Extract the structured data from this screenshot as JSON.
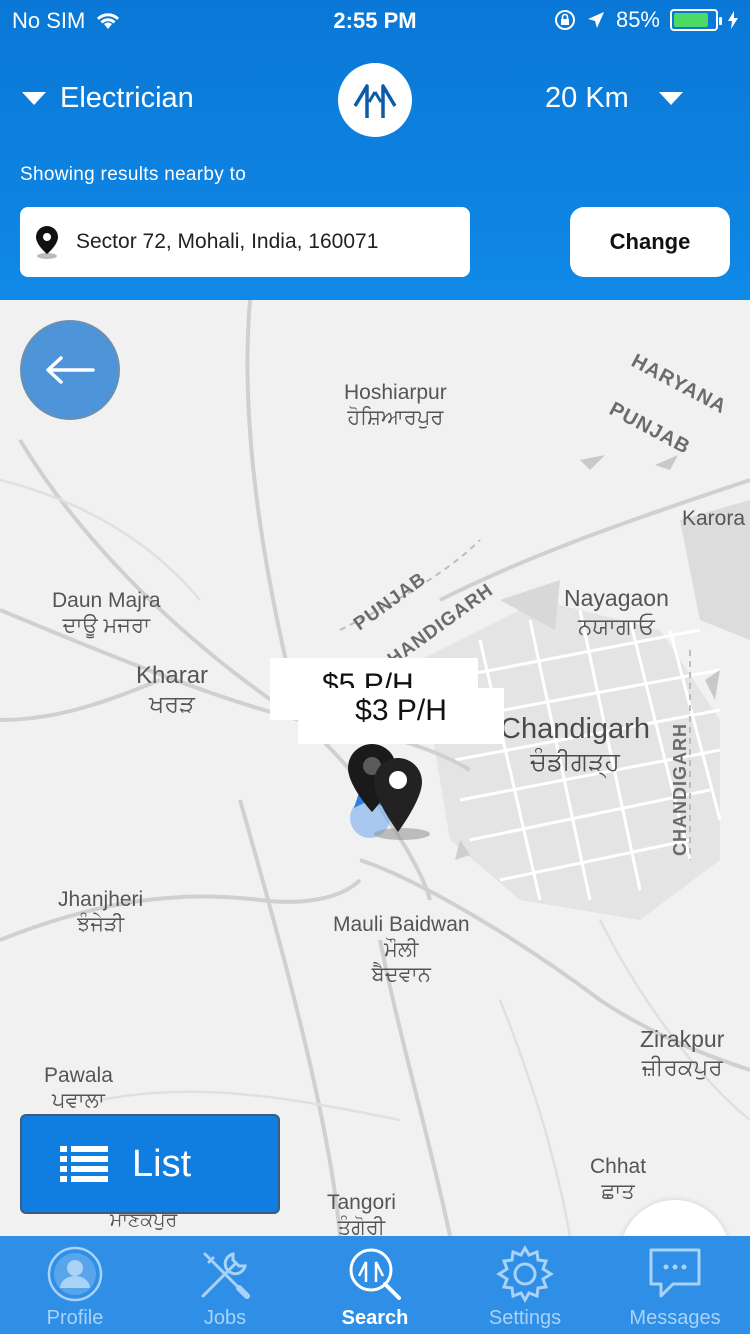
{
  "status_bar": {
    "carrier": "No SIM",
    "time": "2:55 PM",
    "battery": "85%",
    "battery_level": 0.85,
    "battery_color": "#4cd964"
  },
  "header": {
    "category": "Electrician",
    "distance": "20 Km",
    "nearby_label": "Showing results nearby to",
    "address": "Sector 72, Mohali, India, 160071",
    "change_label": "Change",
    "accent_color": "#0a77d6"
  },
  "map": {
    "places": {
      "hoshiarpur": "Hoshiarpur",
      "hoshiarpur_local": "ਹੋਸ਼ਿਆਰਪੁਰ",
      "karora": "Karora",
      "daun_majra": "Daun Majra",
      "daun_majra_local": "ਦਾਊ ਮਜਰਾ",
      "nayagaon": "Nayagaon",
      "nayagaon_local": "ਨਯਾਗਾਓ",
      "kharar": "Kharar",
      "kharar_local": "ਖਰੜ",
      "chandigarh": "Chandigarh",
      "chandigarh_local": "ਚੰਡੀਗੜ੍ਹ",
      "jhanjheri": "Jhanjheri",
      "jhanjheri_local": "ਝੰਜੇੜੀ",
      "mauli_baidwan": "Mauli Baidwan",
      "mauli_local_1": "ਮੌਲੀ",
      "mauli_local_2": "ਬੈਦਵਾਨ",
      "zirakpur": "Zirakpur",
      "zirakpur_local": "ਜ਼ੀਰਕਪੁਰ",
      "pawala": "Pawala",
      "pawala_local": "ਪਵਾਲਾ",
      "chhat": "Chhat",
      "chhat_local": "ਛਾਤ",
      "tangori": "Tangori",
      "tangori_local": "ਤੰਗੋਰੀ",
      "manakpur_local": "ਮਾਣਕਪੁਰ"
    },
    "regions": {
      "haryana": "HARYANA",
      "punjab_ne": "PUNJAB",
      "punjab_center": "PUNJAB",
      "chandigarh_diag": "CHANDIGARH",
      "chandigarh_vert": "CHANDIGARH"
    },
    "prices": [
      "$5 P/H",
      "$3 P/H"
    ],
    "list_label": "List"
  },
  "tabbar": {
    "items": [
      {
        "label": "Profile",
        "icon": "profile-icon"
      },
      {
        "label": "Jobs",
        "icon": "tools-icon"
      },
      {
        "label": "Search",
        "icon": "search-icon"
      },
      {
        "label": "Settings",
        "icon": "gear-icon"
      },
      {
        "label": "Messages",
        "icon": "chat-icon"
      }
    ],
    "active": "Search"
  }
}
